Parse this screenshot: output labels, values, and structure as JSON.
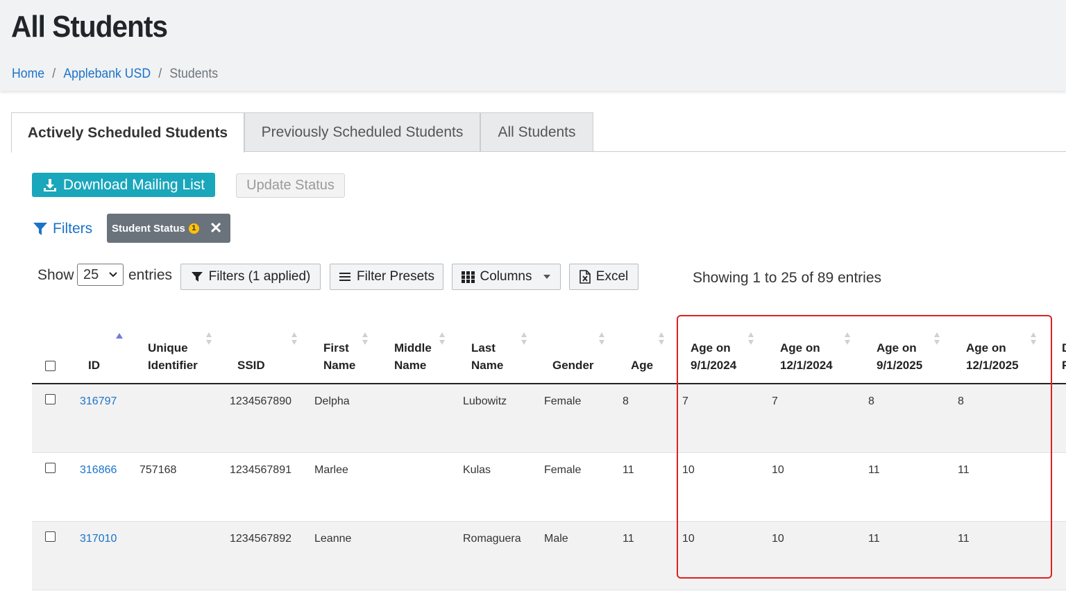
{
  "page": {
    "title": "All Students",
    "breadcrumb": [
      "Home",
      "Applebank USD",
      "Students"
    ]
  },
  "tabs": [
    {
      "label": "Actively Scheduled Students",
      "active": true
    },
    {
      "label": "Previously Scheduled Students",
      "active": false
    },
    {
      "label": "All Students",
      "active": false
    }
  ],
  "actions": {
    "download_label": "Download Mailing List",
    "update_status_label": "Update Status"
  },
  "filters": {
    "link_label": "Filters",
    "chip_label": "Student Status",
    "chip_count": "1"
  },
  "toolbar": {
    "show_label": "Show",
    "entries_value": "25",
    "entries_label": "entries",
    "filters_button": "Filters (1 applied)",
    "presets_button": "Filter Presets",
    "columns_button": "Columns",
    "excel_button": "Excel",
    "info": "Showing 1 to 25 of 89 entries"
  },
  "table": {
    "columns": [
      {
        "key": "id",
        "line1": "",
        "line2": "ID"
      },
      {
        "key": "uid",
        "line1": "Unique",
        "line2": "Identifier"
      },
      {
        "key": "ssid",
        "line1": "",
        "line2": "SSID"
      },
      {
        "key": "first",
        "line1": "First",
        "line2": "Name"
      },
      {
        "key": "middle",
        "line1": "Middle",
        "line2": "Name"
      },
      {
        "key": "last",
        "line1": "Last",
        "line2": "Name"
      },
      {
        "key": "gender",
        "line1": "",
        "line2": "Gender"
      },
      {
        "key": "age",
        "line1": "",
        "line2": "Age"
      },
      {
        "key": "age_0901_2024",
        "line1": "Age on",
        "line2": "9/1/2024"
      },
      {
        "key": "age_1201_2024",
        "line1": "Age on",
        "line2": "12/1/2024"
      },
      {
        "key": "age_0901_2025",
        "line1": "Age on",
        "line2": "9/1/2025"
      },
      {
        "key": "age_1201_2025",
        "line1": "Age on",
        "line2": "12/1/2025"
      },
      {
        "key": "cut",
        "line1": "D",
        "line2": "F"
      }
    ],
    "rows": [
      {
        "id": "316797",
        "uid": "",
        "ssid": "1234567890",
        "first": "Delpha",
        "middle": "",
        "last": "Lubowitz",
        "gender": "Female",
        "age": "8",
        "a1": "7",
        "a2": "7",
        "a3": "8",
        "a4": "8"
      },
      {
        "id": "316866",
        "uid": "757168",
        "ssid": "1234567891",
        "first": "Marlee",
        "middle": "",
        "last": "Kulas",
        "gender": "Female",
        "age": "11",
        "a1": "10",
        "a2": "10",
        "a3": "11",
        "a4": "11"
      },
      {
        "id": "317010",
        "uid": "",
        "ssid": "1234567892",
        "first": "Leanne",
        "middle": "",
        "last": "Romaguera",
        "gender": "Male",
        "age": "11",
        "a1": "10",
        "a2": "10",
        "a3": "11",
        "a4": "11"
      }
    ]
  },
  "colors": {
    "primary_button": "#1aa6bb",
    "link": "#1a73c8",
    "chip": "#6a737b",
    "highlight": "#e02020"
  }
}
